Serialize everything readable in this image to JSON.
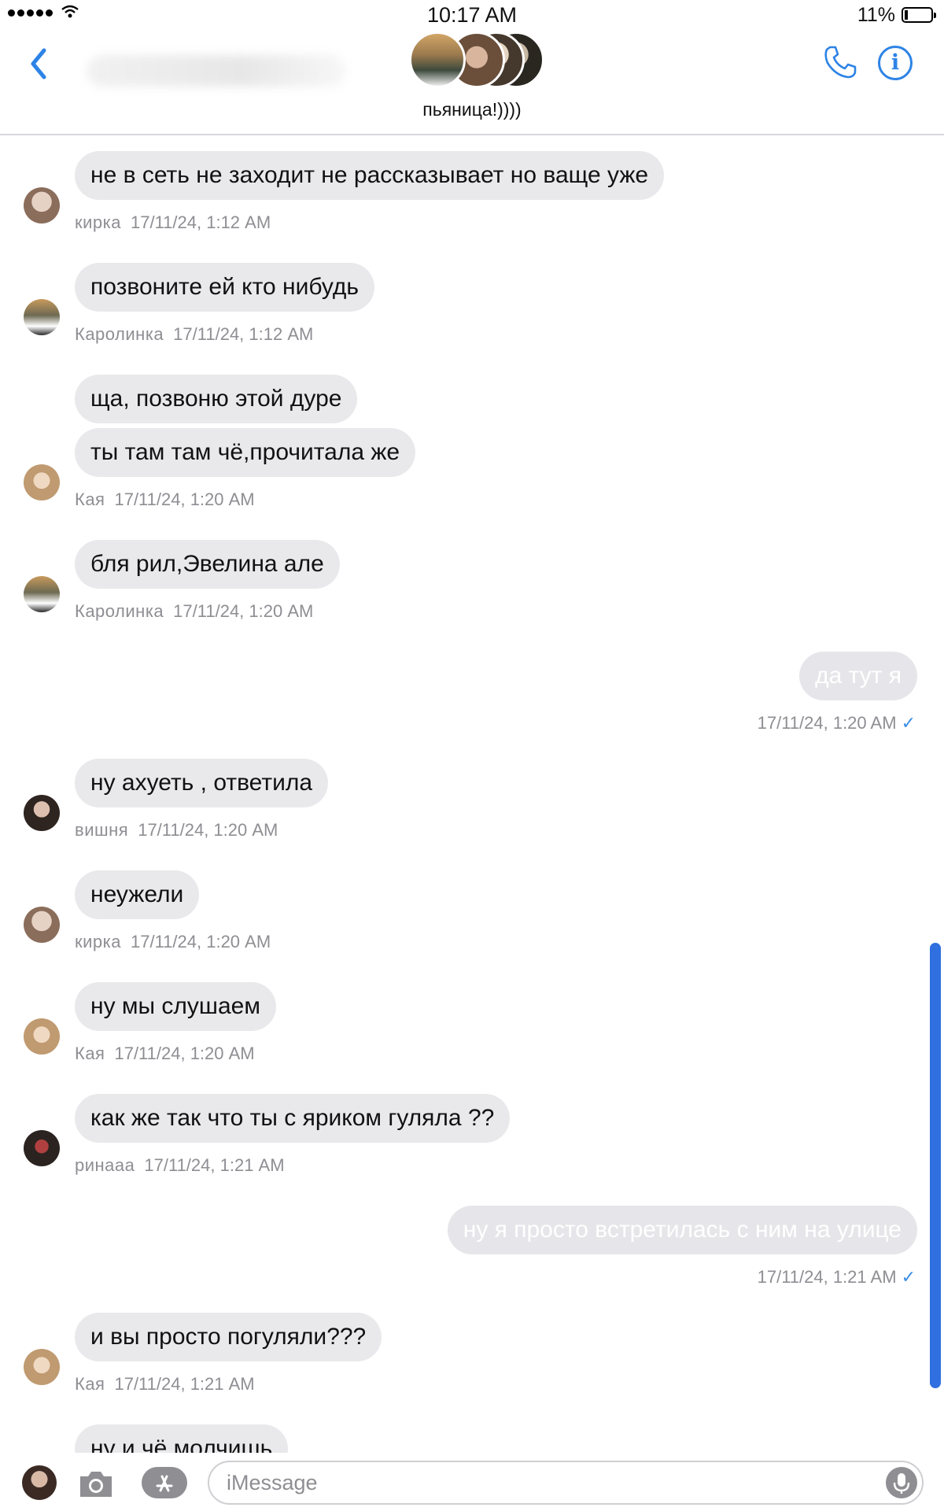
{
  "status_bar": {
    "time": "10:17 AM",
    "battery": "11%"
  },
  "header": {
    "title": "пьяница!))))",
    "back": "back",
    "call_icon": "phone-icon",
    "info_icon": "info-icon",
    "info_glyph": "i"
  },
  "colors": {
    "accent": "#2d83e6",
    "incoming_bubble": "#e9e9ec",
    "meta_text": "#8e8e93",
    "read_check": "#3a8ee6"
  },
  "messages": [
    {
      "text": "не в сеть не заходит не рассказывает но ваще уже",
      "sender": "кирка",
      "time": "17/11/24, 1:12 AM"
    },
    {
      "text": "позвоните ей кто нибудь",
      "sender": "Каролинка",
      "time": "17/11/24, 1:12 AM"
    },
    {
      "text": "ща, позвоню этой дуре"
    },
    {
      "text": "ты там там чё,прочитала же",
      "sender": "Кая",
      "time": "17/11/24, 1:20 AM"
    },
    {
      "text": "бля рил,Эвелина але",
      "sender": "Каролинка",
      "time": "17/11/24, 1:20 AM"
    },
    {
      "text": "да тут я",
      "time": "17/11/24, 1:20 AM",
      "check": "✓"
    },
    {
      "text": "ну ахуеть , ответила",
      "sender": "вишня",
      "time": "17/11/24, 1:20 AM"
    },
    {
      "text": "неужели",
      "sender": "кирка",
      "time": "17/11/24, 1:20 AM"
    },
    {
      "text": "ну мы слушаем",
      "sender": "Кая",
      "time": "17/11/24, 1:20 AM"
    },
    {
      "text": "как же так что ты с яриком гуляла ??",
      "sender": "ринааа",
      "time": "17/11/24, 1:21 AM"
    },
    {
      "text": "ну я просто встретилась с ним на улице",
      "time": "17/11/24, 1:21 AM",
      "check": "✓"
    },
    {
      "text": "и вы просто погуляли???",
      "sender": "Кая",
      "time": "17/11/24, 1:21 AM"
    },
    {
      "text": "ну и чё молчишь"
    }
  ],
  "input": {
    "placeholder": "iMessage",
    "value": ""
  }
}
